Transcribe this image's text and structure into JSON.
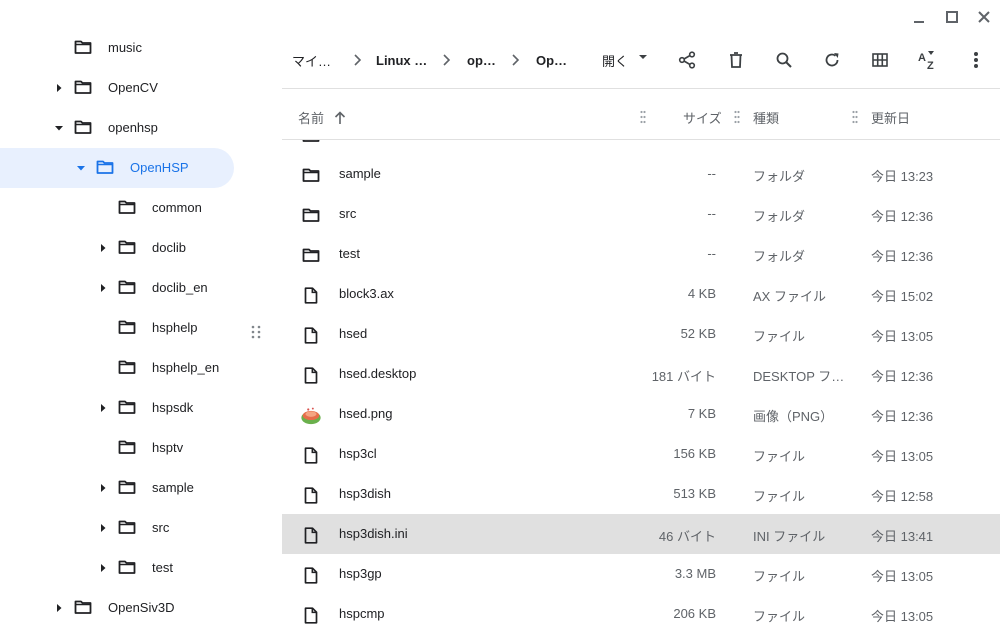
{
  "window": {
    "minimize_icon": "minimize-icon",
    "maximize_icon": "maximize-icon",
    "close_icon": "close-icon"
  },
  "sidebar": {
    "items": [
      {
        "label": "music",
        "expander": "none",
        "selected": false
      },
      {
        "label": "OpenCV",
        "expander": "collapsed",
        "selected": false
      },
      {
        "label": "openhsp",
        "expander": "expanded",
        "selected": false
      },
      {
        "label": "OpenHSP",
        "expander": "expanded",
        "selected": true
      },
      {
        "label": "common",
        "expander": "none",
        "selected": false
      },
      {
        "label": "doclib",
        "expander": "collapsed",
        "selected": false
      },
      {
        "label": "doclib_en",
        "expander": "collapsed",
        "selected": false
      },
      {
        "label": "hsphelp",
        "expander": "none",
        "selected": false
      },
      {
        "label": "hsphelp_en",
        "expander": "none",
        "selected": false
      },
      {
        "label": "hspsdk",
        "expander": "collapsed",
        "selected": false
      },
      {
        "label": "hsptv",
        "expander": "none",
        "selected": false
      },
      {
        "label": "sample",
        "expander": "collapsed",
        "selected": false
      },
      {
        "label": "src",
        "expander": "collapsed",
        "selected": false
      },
      {
        "label": "test",
        "expander": "collapsed",
        "selected": false
      },
      {
        "label": "OpenSiv3D",
        "expander": "collapsed",
        "selected": false
      }
    ]
  },
  "breadcrumb": [
    "マイ…",
    "Linux …",
    "op…",
    "Op…"
  ],
  "toolbar": {
    "open_label": "開く",
    "icons": [
      "share-icon",
      "delete-icon",
      "search-icon",
      "refresh-icon",
      "grid-view-icon",
      "sort-az-icon",
      "more-icon"
    ]
  },
  "columns": {
    "name": "名前",
    "size": "サイズ",
    "type": "種類",
    "date": "更新日"
  },
  "files": [
    {
      "name": "sample",
      "size": "--",
      "type": "フォルダ",
      "date": "今日 13:23",
      "icon": "folder",
      "selected": false
    },
    {
      "name": "src",
      "size": "--",
      "type": "フォルダ",
      "date": "今日 12:36",
      "icon": "folder",
      "selected": false
    },
    {
      "name": "test",
      "size": "--",
      "type": "フォルダ",
      "date": "今日 12:36",
      "icon": "folder",
      "selected": false
    },
    {
      "name": "block3.ax",
      "size": "4 KB",
      "type": "AX ファイル",
      "date": "今日 15:02",
      "icon": "file",
      "selected": false
    },
    {
      "name": "hsed",
      "size": "52 KB",
      "type": "ファイル",
      "date": "今日 13:05",
      "icon": "file",
      "selected": false
    },
    {
      "name": "hsed.desktop",
      "size": "181 バイト",
      "type": "DESKTOP フ…",
      "date": "今日 12:36",
      "icon": "file",
      "selected": false
    },
    {
      "name": "hsed.png",
      "size": "7 KB",
      "type": "画像（PNG）",
      "date": "今日 12:36",
      "icon": "image",
      "selected": false
    },
    {
      "name": "hsp3cl",
      "size": "156 KB",
      "type": "ファイル",
      "date": "今日 13:05",
      "icon": "file",
      "selected": false
    },
    {
      "name": "hsp3dish",
      "size": "513 KB",
      "type": "ファイル",
      "date": "今日 12:58",
      "icon": "file",
      "selected": false
    },
    {
      "name": "hsp3dish.ini",
      "size": "46 バイト",
      "type": "INI ファイル",
      "date": "今日 13:41",
      "icon": "file",
      "selected": true
    },
    {
      "name": "hsp3gp",
      "size": "3.3 MB",
      "type": "ファイル",
      "date": "今日 13:05",
      "icon": "file",
      "selected": false
    },
    {
      "name": "hspcmp",
      "size": "206 KB",
      "type": "ファイル",
      "date": "今日 13:05",
      "icon": "file",
      "selected": false
    }
  ],
  "colors": {
    "selected_tree_bg": "#e8f0fe",
    "selected_tree_text": "#1a73e8",
    "selected_row_bg": "#e0e0e0"
  }
}
